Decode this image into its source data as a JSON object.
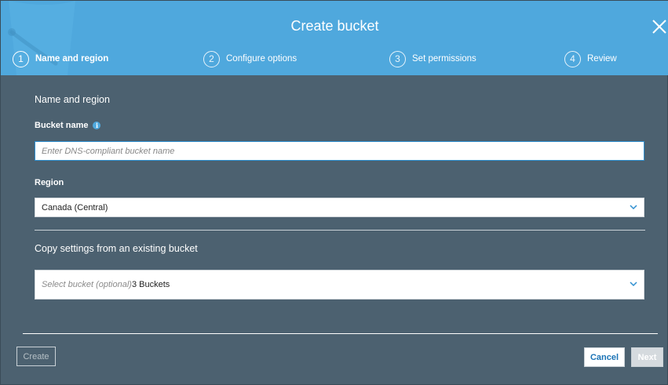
{
  "dialog": {
    "title": "Create bucket",
    "close_label": "×"
  },
  "steps": [
    {
      "num": "1",
      "label": "Name and region",
      "active": true
    },
    {
      "num": "2",
      "label": "Configure options",
      "active": false
    },
    {
      "num": "3",
      "label": "Set permissions",
      "active": false
    },
    {
      "num": "4",
      "label": "Review",
      "active": false
    }
  ],
  "name_region": {
    "section_title": "Name and region",
    "bucket_name_label": "Bucket name",
    "bucket_name_placeholder": "Enter DNS-compliant bucket name",
    "bucket_name_value": "",
    "info_icon": "info-icon",
    "region_label": "Region",
    "region_value": "Canada (Central)"
  },
  "copy_settings": {
    "section_title": "Copy settings from an existing bucket",
    "select_placeholder": "Select bucket (optional)",
    "select_count": "3 Buckets"
  },
  "footer": {
    "create_label": "Create",
    "cancel_label": "Cancel",
    "next_label": "Next"
  },
  "colors": {
    "header_bg": "#4fa8dd",
    "body_bg": "#4c6170",
    "accent": "#2e8fd0",
    "link": "#1a73b6"
  }
}
